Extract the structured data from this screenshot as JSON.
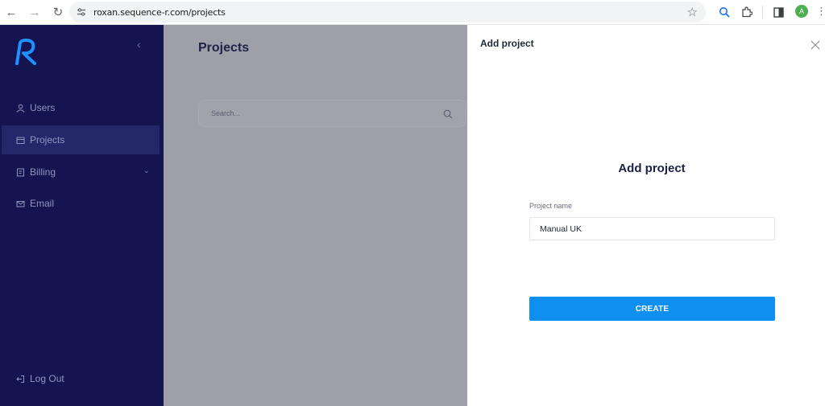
{
  "browser": {
    "url": "roxan.sequence-r.com/projects",
    "profile_initial": "A"
  },
  "sidebar": {
    "items": [
      {
        "label": "Users",
        "icon": "user-icon"
      },
      {
        "label": "Projects",
        "icon": "folder-icon"
      },
      {
        "label": "Billing",
        "icon": "billing-icon"
      },
      {
        "label": "Email",
        "icon": "mail-icon"
      }
    ],
    "logout_label": "Log Out"
  },
  "main": {
    "title": "Projects",
    "search_placeholder": "Search..."
  },
  "drawer": {
    "title": "Add project",
    "form_heading": "Add project",
    "field_label": "Project name",
    "field_value": "Manual UK",
    "create_label": "CREATE"
  },
  "colors": {
    "sidebar_bg": "#141450",
    "sidebar_active": "#24286a",
    "overlay": "#9f9fa8",
    "primary": "#0f8ff0",
    "logo_blue": "#1e90ff"
  }
}
